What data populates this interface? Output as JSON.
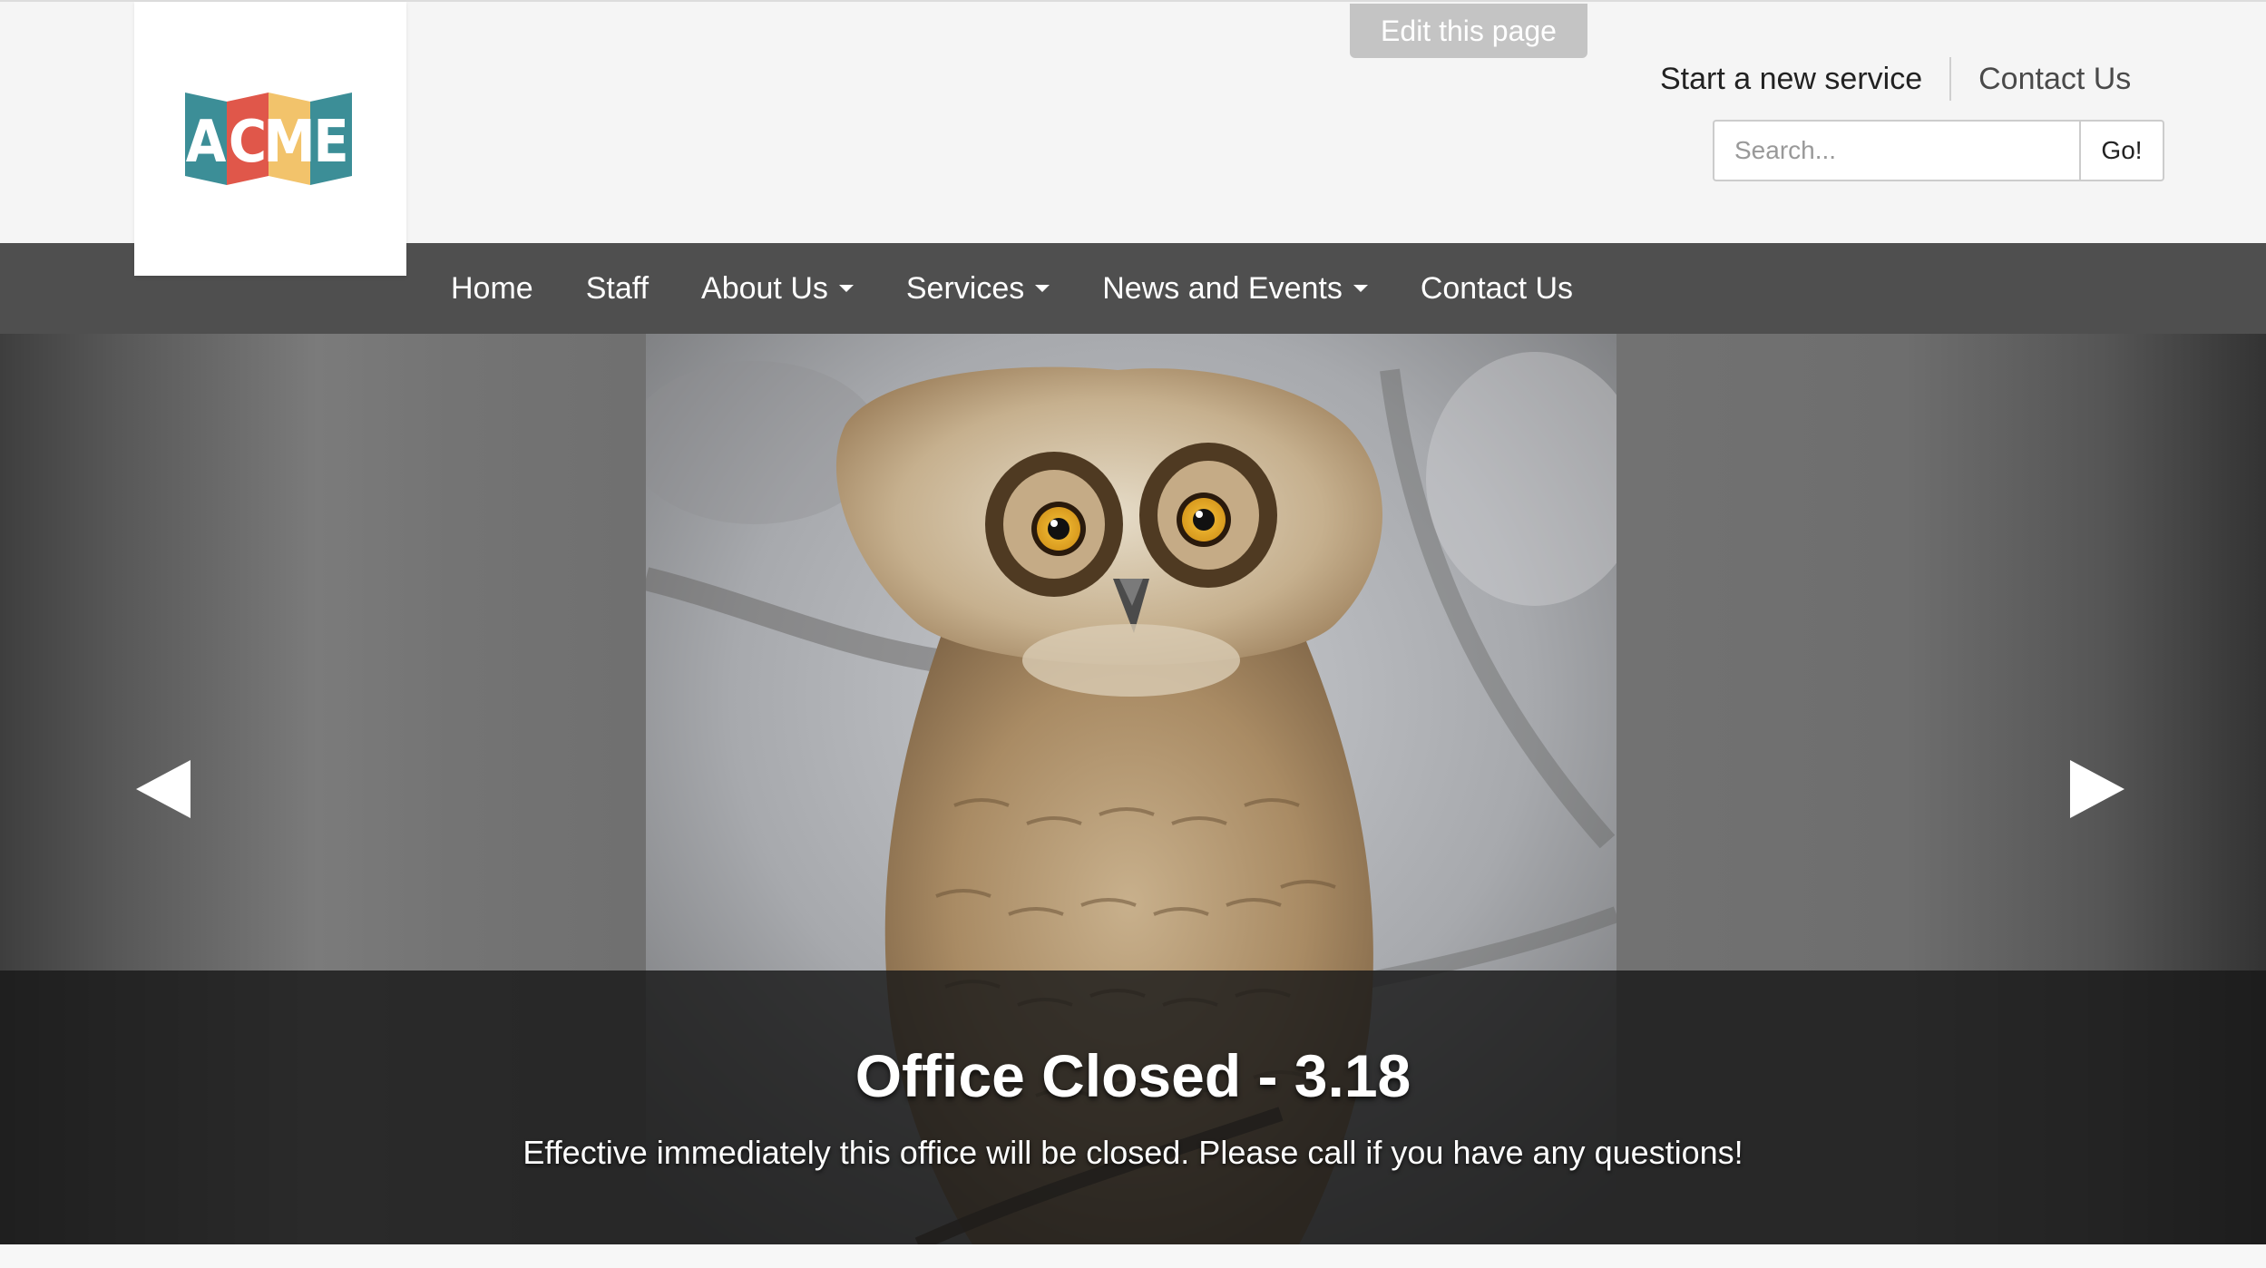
{
  "header": {
    "logo_text": "ACME",
    "edit_page_label": "Edit this page",
    "utility_links": {
      "start_service": "Start a new service",
      "contact": "Contact Us"
    },
    "search": {
      "placeholder": "Search...",
      "button_label": "Go!"
    }
  },
  "nav": {
    "items": [
      {
        "label": "Home",
        "has_dropdown": false
      },
      {
        "label": "Staff",
        "has_dropdown": false
      },
      {
        "label": "About Us",
        "has_dropdown": true
      },
      {
        "label": "Services",
        "has_dropdown": true
      },
      {
        "label": "News and Events",
        "has_dropdown": true
      },
      {
        "label": "Contact Us",
        "has_dropdown": false
      }
    ]
  },
  "carousel": {
    "slide_title": "Office Closed - 3.18",
    "slide_text": "Effective immediately this office will be closed. Please call if you have any questions!",
    "prev_icon": "left-triangle-icon",
    "next_icon": "right-triangle-icon"
  },
  "colors": {
    "nav_bg": "#4f4f4f",
    "edit_button_bg": "#c4c4c4",
    "logo_teal": "#3c8e97",
    "logo_red": "#e0574a",
    "logo_yellow": "#f2c36b"
  }
}
